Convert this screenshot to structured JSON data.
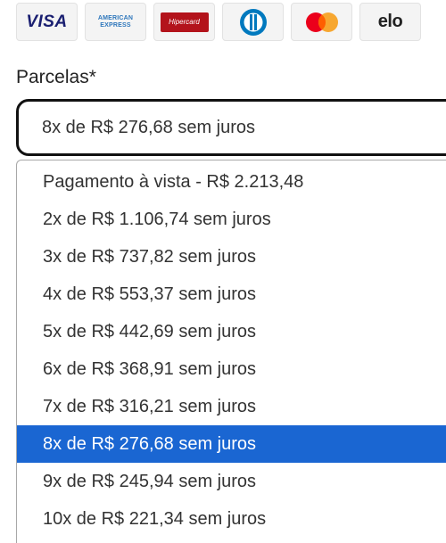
{
  "brands": [
    {
      "name": "visa",
      "text": "VISA"
    },
    {
      "name": "amex",
      "text": "AMERICAN EXPRESS"
    },
    {
      "name": "hipercard",
      "text": "Hipercard"
    },
    {
      "name": "diners",
      "text": ""
    },
    {
      "name": "mastercard",
      "text": ""
    },
    {
      "name": "elo",
      "text": "elo"
    }
  ],
  "installments": {
    "label": "Parcelas*",
    "selected_value": "8x de R$ 276,68 sem juros",
    "selected_index": 7,
    "options": [
      "Pagamento à vista - R$ 2.213,48",
      "2x de R$ 1.106,74 sem juros",
      "3x de R$ 737,82 sem juros",
      "4x de R$ 553,37 sem juros",
      "5x de R$ 442,69 sem juros",
      "6x de R$ 368,91 sem juros",
      "7x de R$ 316,21 sem juros",
      "8x de R$ 276,68 sem juros",
      "9x de R$ 245,94 sem juros",
      "10x de R$ 221,34 sem juros"
    ]
  },
  "colors": {
    "selected_bg": "#1a66d2",
    "visa_blue": "#1a1f71",
    "amex_blue": "#2e77bc",
    "hipercard_red": "#b3131b",
    "diners_blue": "#0079be",
    "mastercard_red": "#eb001b",
    "mastercard_orange": "#f79e1b"
  }
}
